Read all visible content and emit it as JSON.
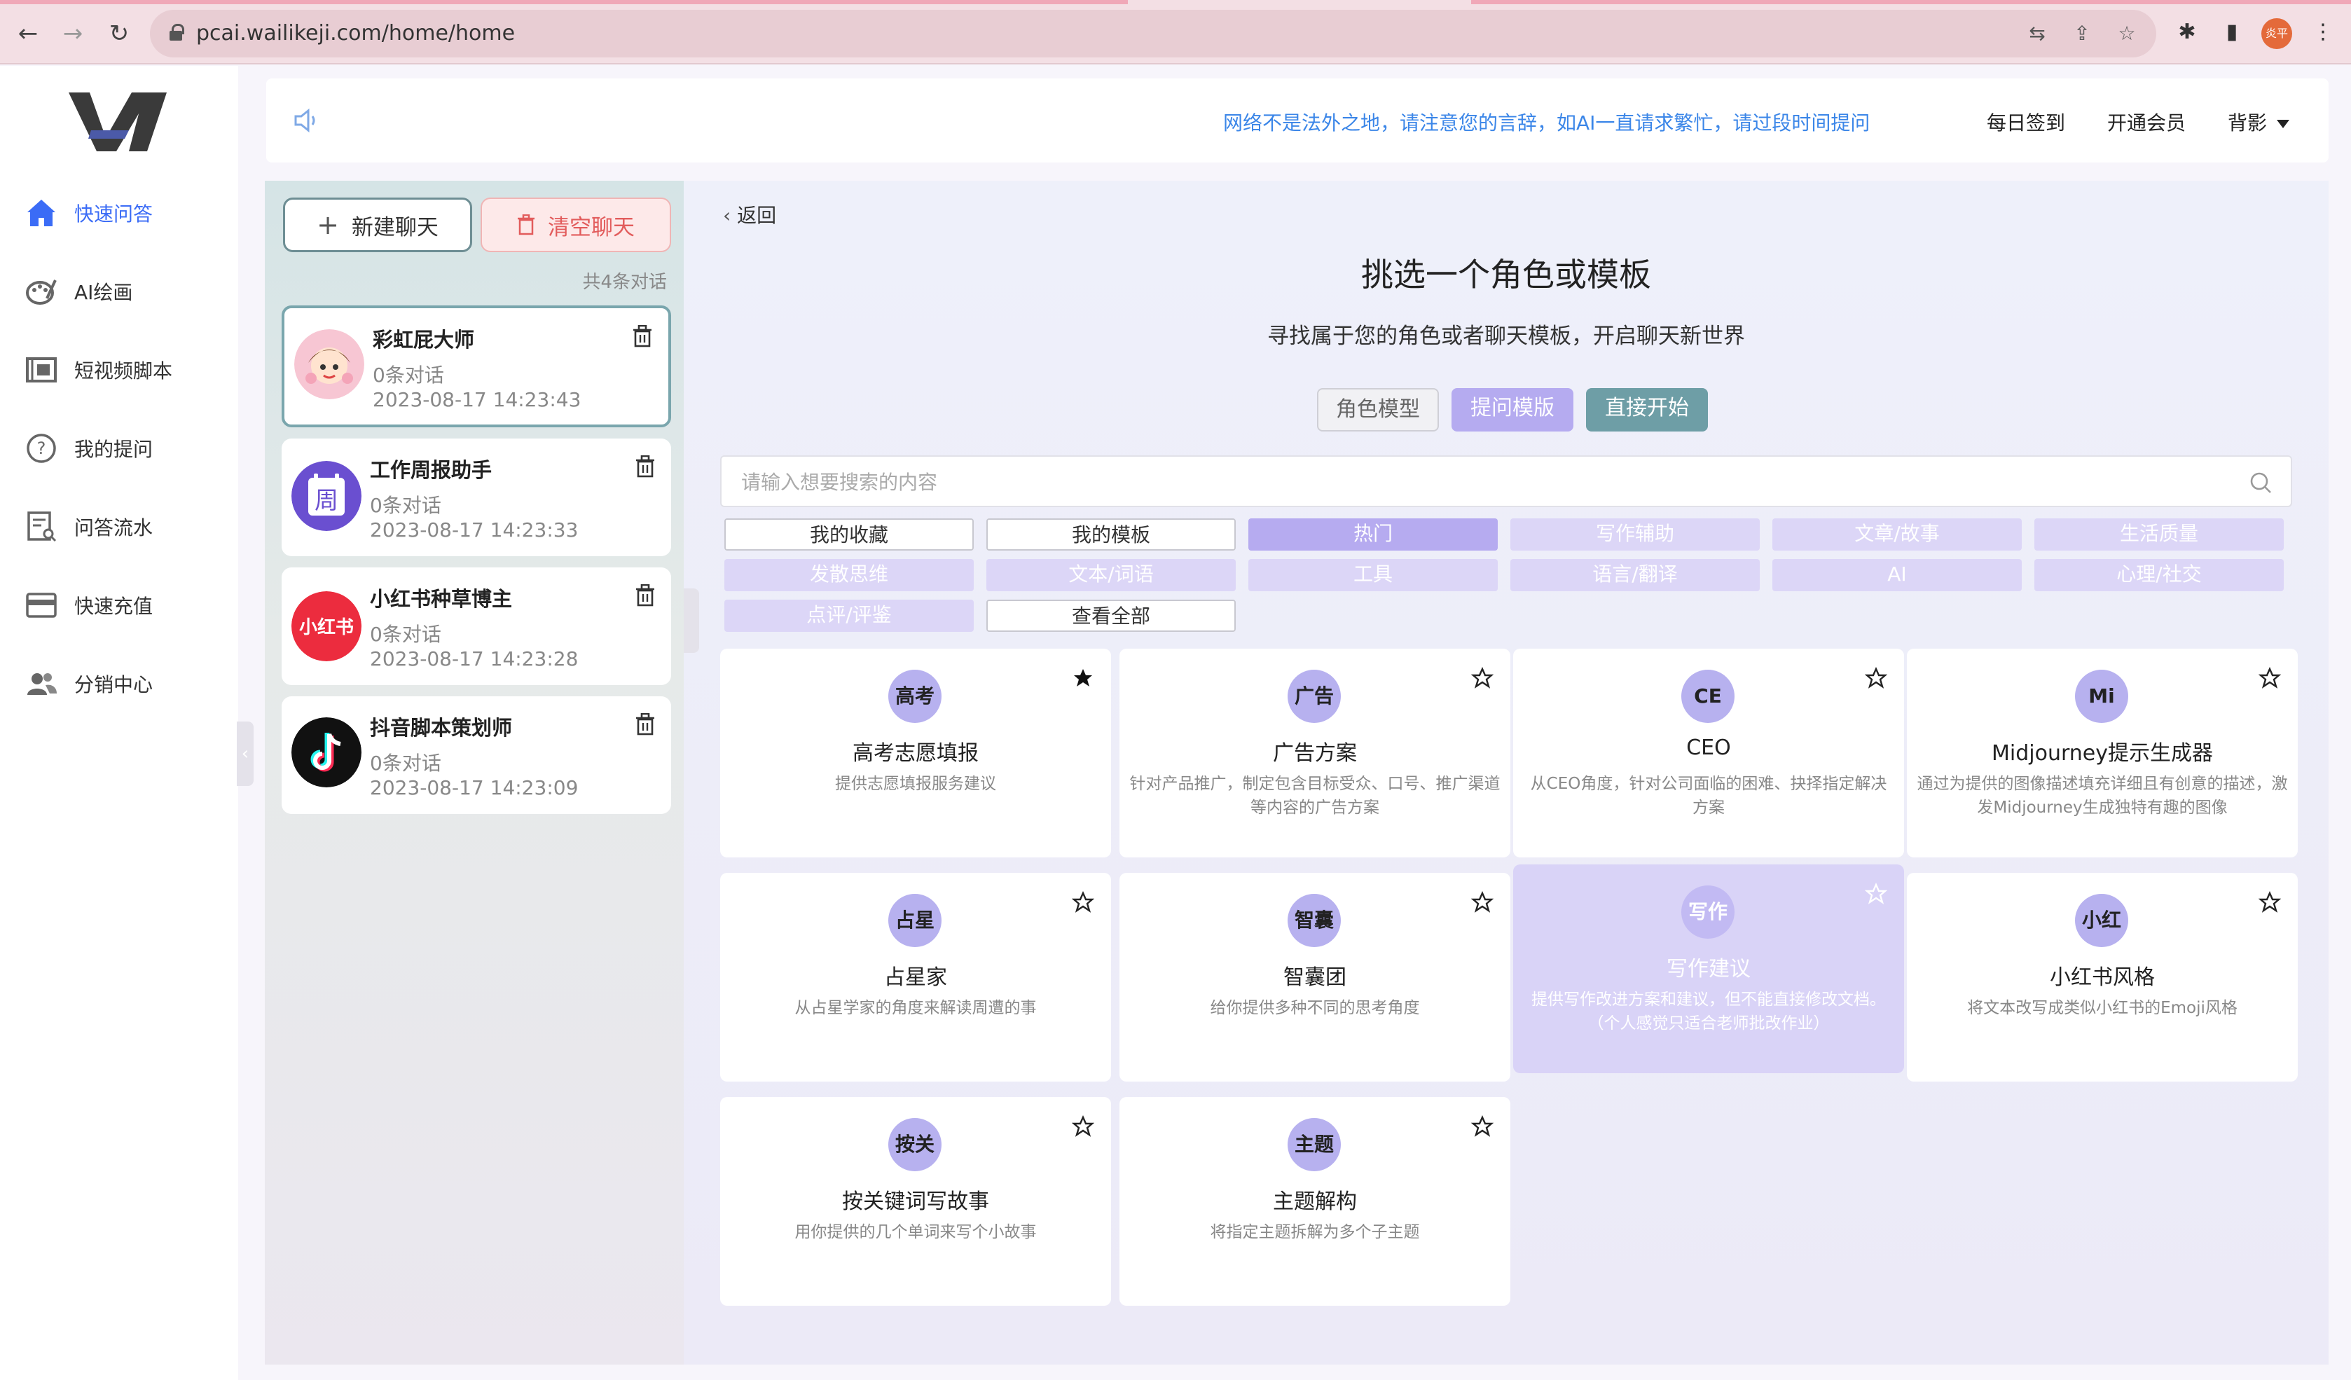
{
  "browser": {
    "url": "pcai.wailikeji.com/home/home",
    "profile_label": "炎平"
  },
  "sidebar": {
    "items": [
      {
        "label": "快速问答",
        "icon": "home-icon"
      },
      {
        "label": "AI绘画",
        "icon": "palette-icon"
      },
      {
        "label": "短视频脚本",
        "icon": "film-icon"
      },
      {
        "label": "我的提问",
        "icon": "question-icon"
      },
      {
        "label": "问答流水",
        "icon": "receipt-search-icon"
      },
      {
        "label": "快速充值",
        "icon": "card-icon"
      },
      {
        "label": "分销中心",
        "icon": "users-icon"
      }
    ]
  },
  "notice": {
    "text": "网络不是法外之地，请注意您的言辞，如AI一直请求繁忙，请过段时间提问",
    "checkin": "每日签到",
    "vip": "开通会员",
    "theme": "背影"
  },
  "chat": {
    "new_label": "新建聊天",
    "clear_label": "清空聊天",
    "count": "共4条对话",
    "items": [
      {
        "name": "彩虹屁大师",
        "sub": "0条对话",
        "time": "2023-08-17 14:23:43"
      },
      {
        "name": "工作周报助手",
        "sub": "0条对话",
        "time": "2023-08-17 14:23:33"
      },
      {
        "name": "小红书种草博主",
        "sub": "0条对话",
        "time": "2023-08-17 14:23:28"
      },
      {
        "name": "抖音脚本策划师",
        "sub": "0条对话",
        "time": "2023-08-17 14:23:09"
      }
    ],
    "avatar_texts": {
      "week": "周",
      "xhs": "小红书"
    }
  },
  "main": {
    "back": "返回",
    "title": "挑选一个角色或模板",
    "subtitle": "寻找属于您的角色或者聊天模板，开启聊天新世界",
    "modes": [
      "角色模型",
      "提问模版",
      "直接开始"
    ],
    "search_placeholder": "请输入想要搜索的内容",
    "tags": [
      "我的收藏",
      "我的模板",
      "热门",
      "写作辅助",
      "文章/故事",
      "生活质量",
      "发散思维",
      "文本/词语",
      "工具",
      "语言/翻译",
      "AI",
      "心理/社交",
      "点评/评鉴",
      "查看全部"
    ],
    "cards": [
      {
        "badge": "高考",
        "title": "高考志愿填报",
        "desc": "提供志愿填报服务建议",
        "starred": true
      },
      {
        "badge": "广告",
        "title": "广告方案",
        "desc": "针对产品推广，制定包含目标受众、口号、推广渠道等内容的广告方案",
        "starred": false
      },
      {
        "badge": "CE",
        "title": "CEO",
        "desc": "从CEO角度，针对公司面临的困难、抉择指定解决方案",
        "starred": false
      },
      {
        "badge": "Mi",
        "title": "Midjourney提示生成器",
        "desc": "通过为提供的图像描述填充详细且有创意的描述，激发Midjourney生成独特有趣的图像",
        "starred": false
      },
      {
        "badge": "占星",
        "title": "占星家",
        "desc": "从占星学家的角度来解读周遭的事",
        "starred": false
      },
      {
        "badge": "智囊",
        "title": "智囊团",
        "desc": "给你提供多种不同的思考角度",
        "starred": false
      },
      {
        "badge": "写作",
        "title": "写作建议",
        "desc": "提供写作改进方案和建议，但不能直接修改文档。（个人感觉只适合老师批改作业）",
        "starred": false
      },
      {
        "badge": "小红",
        "title": "小红书风格",
        "desc": "将文本改写成类似小红书的Emoji风格",
        "starred": false
      },
      {
        "badge": "按关",
        "title": "按关键词写故事",
        "desc": "用你提供的几个单词来写个小故事",
        "starred": false
      },
      {
        "badge": "主题",
        "title": "主题解构",
        "desc": "将指定主题拆解为多个子主题",
        "starred": false
      }
    ]
  },
  "colors": {
    "accent_blue": "#3b6cf6",
    "notice_text": "#3b86e8",
    "tag_active": "#b6abf0",
    "tag_light": "#dcd6f7",
    "mode_active": "#6e9ea6",
    "clear_red": "#e25c5c"
  }
}
